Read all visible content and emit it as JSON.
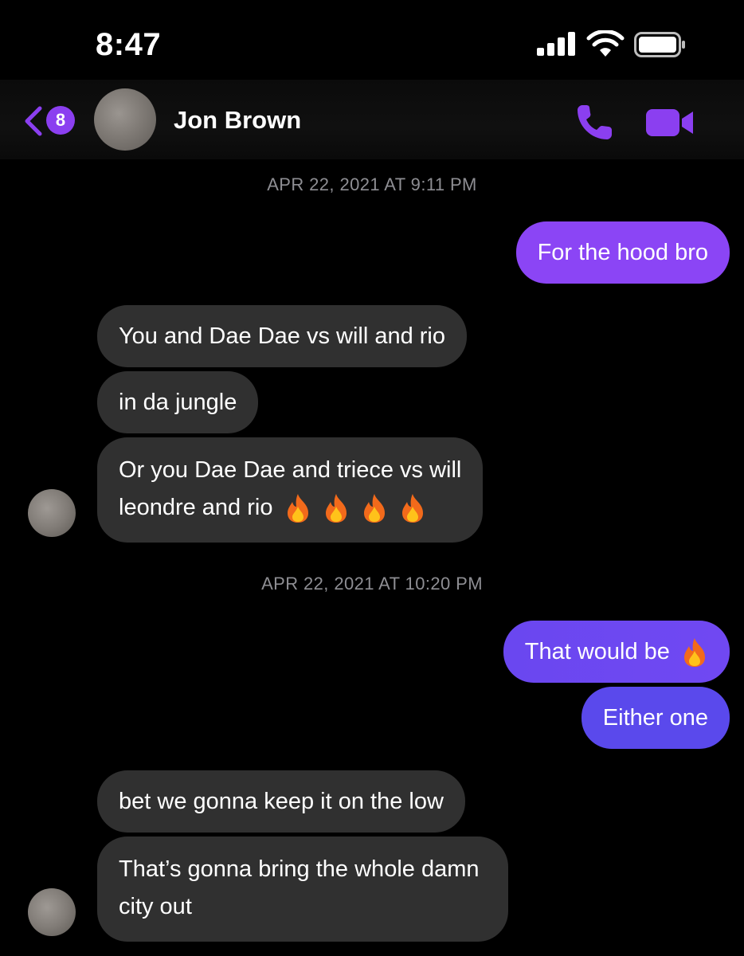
{
  "status_bar": {
    "time": "8:47",
    "icons": [
      "signal-icon",
      "wifi-icon",
      "battery-icon"
    ]
  },
  "header": {
    "back_badge": "8",
    "contact_name": "Jon Brown",
    "icons": [
      "back-chevron-icon",
      "phone-icon",
      "video-camera-icon"
    ],
    "accent_color": "#8b3ff0"
  },
  "timestamps": [
    "APR 22, 2021 AT 9:11 PM",
    "APR 22, 2021 AT 10:20 PM"
  ],
  "messages": [
    {
      "from": "me",
      "text": "For the hood bro"
    },
    {
      "from": "them",
      "text": "You and Dae Dae vs will and rio"
    },
    {
      "from": "them",
      "text": "in da jungle"
    },
    {
      "from": "them",
      "line1": "Or you Dae Dae and triece vs will",
      "line2": "leondre and rio",
      "emoji": [
        "fire-emoji",
        "fire-emoji",
        "fire-emoji",
        "fire-emoji"
      ]
    },
    {
      "from": "me",
      "text": "That would be",
      "emoji": [
        "fire-emoji"
      ]
    },
    {
      "from": "me",
      "text": "Either one"
    },
    {
      "from": "them",
      "text": "bet we gonna keep it on the low"
    },
    {
      "from": "them",
      "line1": "That’s gonna bring the whole damn",
      "line2": "city out"
    }
  ],
  "colors": {
    "incoming_bubble": "#303030",
    "outgoing_purple": "#8b45f5",
    "outgoing_blue_purple": "#6046ee",
    "timestamp_text": "#8e8e93"
  }
}
